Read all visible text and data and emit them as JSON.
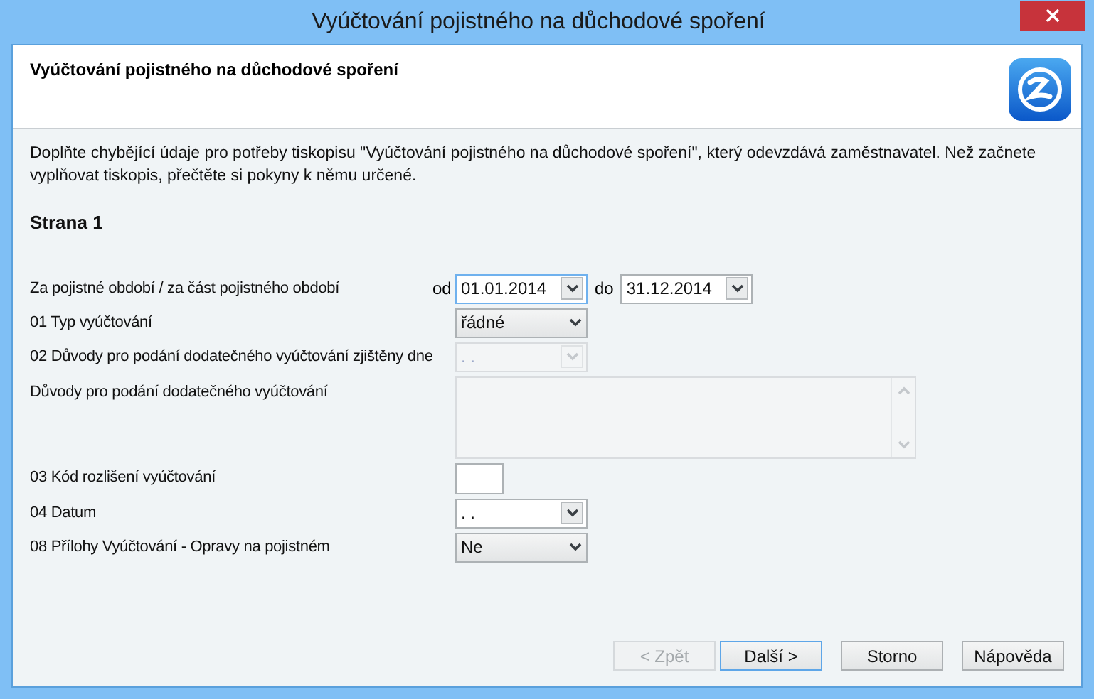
{
  "window": {
    "title": "Vyúčtování pojistného na důchodové spoření"
  },
  "header": {
    "title": "Vyúčtování pojistného na důchodové spoření"
  },
  "intro": "Doplňte chybějící údaje pro potřeby tiskopisu \"Vyúčtování pojistného na důchodové spoření\", který odevzdává zaměstnavatel. Než začnete vyplňovat tiskopis, přečtěte si pokyny k němu určené.",
  "section_title": "Strana 1",
  "rows": [
    {
      "kind": "date_range",
      "label": "Za pojistné období / za část pojistného období",
      "from": {
        "label": "od",
        "value": "01.01.2014",
        "focused": true
      },
      "to": {
        "label": "do",
        "value": "31.12.2014",
        "focused": false
      }
    },
    {
      "kind": "combo",
      "label": "01 Typ vyúčtování",
      "value": "řádné",
      "disabled": false
    },
    {
      "kind": "date",
      "label": "02 Důvody pro podání dodatečného vyúčtování zjištěny dne",
      "value": ". .",
      "disabled": true
    },
    {
      "kind": "textarea",
      "label": "Důvody pro podání dodatečného vyúčtování",
      "disabled": true
    },
    {
      "kind": "text",
      "label": "03 Kód rozlišení vyúčtování",
      "disabled": false
    },
    {
      "kind": "date",
      "label": "04 Datum",
      "value": ". .",
      "disabled": false
    },
    {
      "kind": "combo",
      "label": "08 Přílohy Vyúčtování - Opravy na pojistném",
      "value": "Ne",
      "disabled": false
    }
  ],
  "buttons": [
    {
      "label": "< Zpět",
      "disabled": true,
      "default": false
    },
    {
      "label": "Další >",
      "disabled": false,
      "default": true
    },
    {
      "label": "Storno",
      "disabled": false,
      "default": false
    },
    {
      "label": "Nápověda",
      "disabled": false,
      "default": false
    }
  ]
}
